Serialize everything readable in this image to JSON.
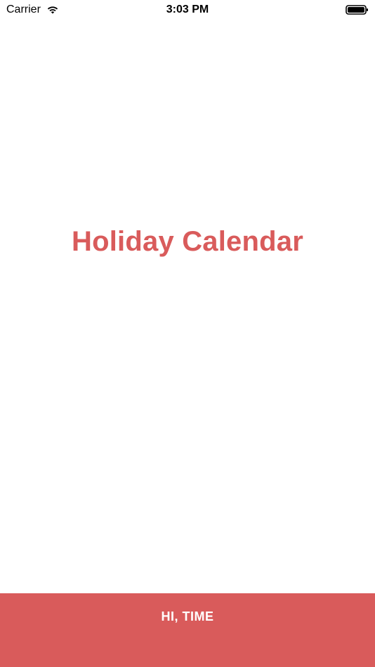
{
  "status_bar": {
    "carrier": "Carrier",
    "time": "3:03 PM",
    "icons": {
      "wifi": "wifi-icon",
      "battery": "battery-icon"
    }
  },
  "main": {
    "title": "Holiday Calendar"
  },
  "bottom_bar": {
    "button_label": "HI, TIME"
  },
  "colors": {
    "accent": "#d95b5b",
    "background": "#ffffff",
    "text_on_accent": "#ffffff"
  }
}
